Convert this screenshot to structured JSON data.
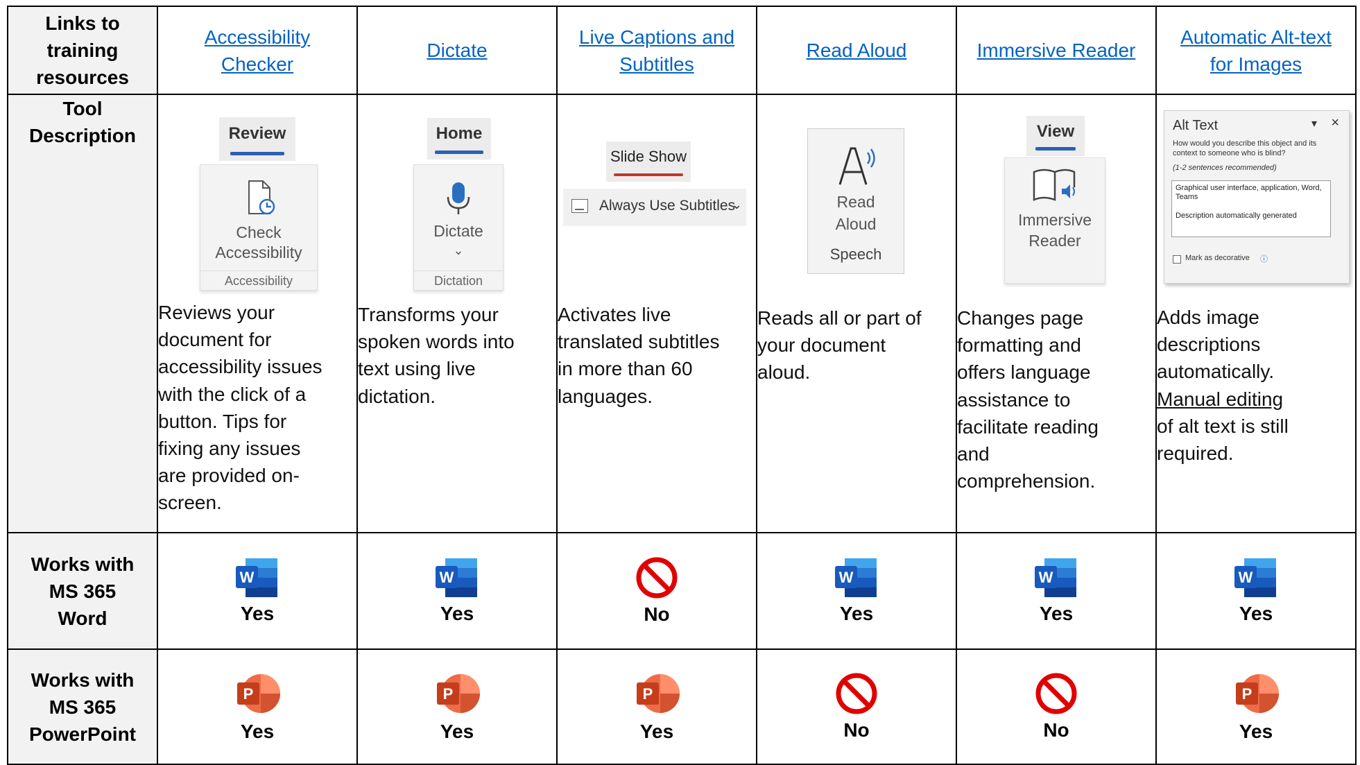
{
  "row_headers": {
    "links": "Links to training resources",
    "description": "Tool Description",
    "word": "Works with MS 365 Word",
    "powerpoint": "Works with MS 365 PowerPoint"
  },
  "row_header_lines": {
    "links": [
      "Links to",
      "training",
      "resources"
    ],
    "description": [
      "Tool",
      "Description"
    ],
    "word": [
      "Works with",
      "MS 365",
      "Word"
    ],
    "powerpoint": [
      "Works with",
      "MS 365",
      "PowerPoint"
    ]
  },
  "tools": [
    {
      "link_lines": [
        "Accessibility",
        "Checker"
      ],
      "ribbon_tab": "Review",
      "button_label_lines": [
        "Check",
        "Accessibility"
      ],
      "group_label": "Accessibility",
      "description_lines": [
        "Reviews your",
        "document for",
        "accessibility issues",
        "with the click of a",
        "button. Tips for",
        "fixing any issues",
        "are provided on-",
        "screen."
      ],
      "word": "Yes",
      "powerpoint": "Yes"
    },
    {
      "link_lines": [
        "Dictate"
      ],
      "ribbon_tab": "Home",
      "button_label_lines": [
        "Dictate"
      ],
      "group_label": "Dictation",
      "description_lines": [
        "Transforms your",
        "spoken words into",
        "text using live",
        "dictation."
      ],
      "word": "Yes",
      "powerpoint": "Yes"
    },
    {
      "link_lines": [
        "Live Captions and",
        "Subtitles"
      ],
      "ribbon_tab": "Slide Show",
      "button_label_lines": [
        "Always Use Subtitles"
      ],
      "description_lines": [
        "Activates live",
        "translated subtitles",
        "in more than 60",
        "languages."
      ],
      "word": "No",
      "powerpoint": "Yes"
    },
    {
      "link_lines": [
        "Read Aloud"
      ],
      "button_label_lines": [
        "Read",
        "Aloud"
      ],
      "group_label": "Speech",
      "description_lines": [
        "Reads all or part of",
        "your document",
        "aloud."
      ],
      "word": "Yes",
      "powerpoint": "No"
    },
    {
      "link_lines": [
        "Immersive Reader"
      ],
      "ribbon_tab": "View",
      "button_label_lines": [
        "Immersive",
        "Reader"
      ],
      "description_lines": [
        "Changes page",
        "formatting and",
        "offers language",
        "assistance to",
        "facilitate reading",
        "and",
        "comprehension."
      ],
      "word": "Yes",
      "powerpoint": "No"
    },
    {
      "link_lines": [
        "Automatic Alt-text",
        "for Images"
      ],
      "alt_pane": {
        "title": "Alt Text",
        "prompt": "How would you describe this object and its context to someone who is blind?",
        "hint": "(1-2 sentences recommended)",
        "field_line1": "Graphical user interface, application, Word, Teams",
        "field_line2": "Description automatically generated",
        "checkbox": "Mark as decorative"
      },
      "description_lines": [
        "Adds image",
        "descriptions",
        "automatically.",
        "Manual editing",
        "of alt text is still",
        "required."
      ],
      "word": "Yes",
      "powerpoint": "Yes"
    }
  ],
  "colors": {
    "link": "#0563c1",
    "header_bg": "#f2f2f2",
    "word_blue": "#185abd",
    "ppt_orange": "#c43e1c",
    "no_red": "#e00000",
    "review_bar": "#2b5fb4",
    "slideshow_bar": "#c0392b"
  },
  "icons": {
    "word": "ms-word-icon",
    "powerpoint": "ms-powerpoint-icon",
    "no": "prohibited-icon"
  }
}
